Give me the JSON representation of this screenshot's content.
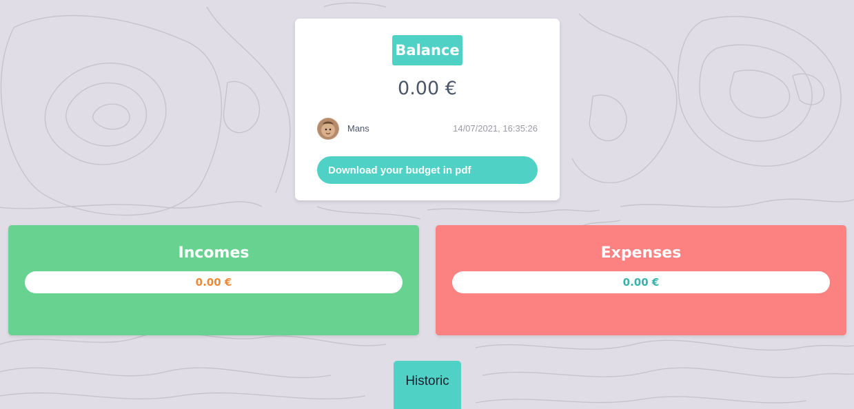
{
  "balance": {
    "title": "Balance",
    "amount": "0.00 €",
    "user_name": "Mans",
    "timestamp": "14/07/2021, 16:35:26",
    "download_label": "Download your budget in pdf"
  },
  "incomes": {
    "title": "Incomes",
    "value": "0.00 €"
  },
  "expenses": {
    "title": "Expenses",
    "value": "0.00 €"
  },
  "historic": {
    "label": "Historic"
  },
  "colors": {
    "accent": "#4fd1c5",
    "incomes": "#68d391",
    "expenses": "#fc8181",
    "income_value": "#ed8936",
    "expense_value": "#38b2ac",
    "background": "#e0dde7"
  },
  "icons": {
    "avatar": "user-avatar-photo",
    "background": "topographic-contour-pattern"
  }
}
